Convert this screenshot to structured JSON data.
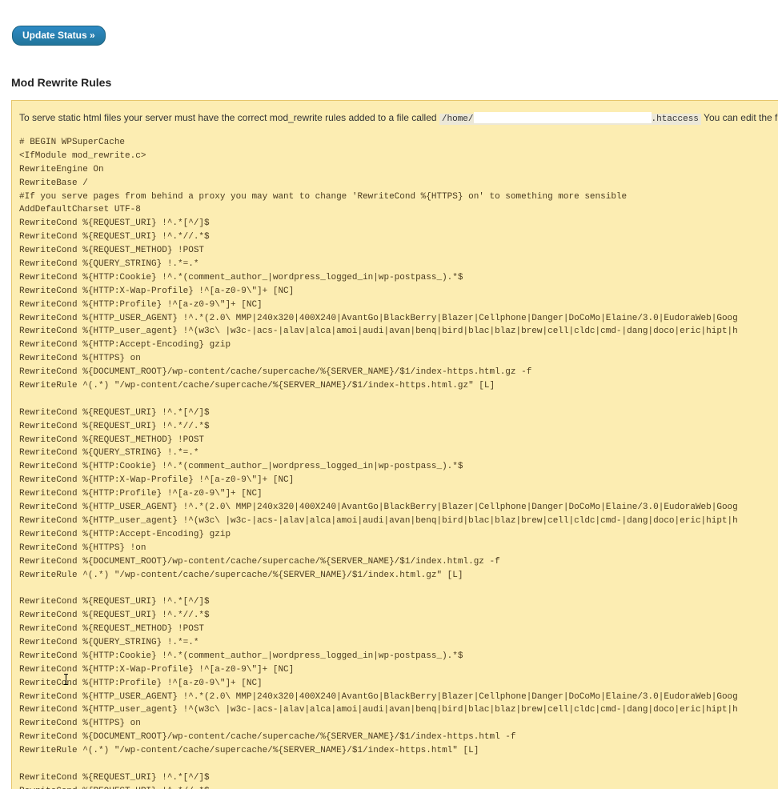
{
  "update_button": {
    "label": "Update Status »"
  },
  "section_title": "Mod Rewrite Rules",
  "notice": {
    "intro_before": "To serve static html files your server must have the correct mod_rewrite rules added to a file called ",
    "path_prefix": "/home/",
    "path_suffix": ".htaccess",
    "intro_after": " You can edit the f"
  },
  "rules_lines": [
    "# BEGIN WPSuperCache",
    "<IfModule mod_rewrite.c>",
    "RewriteEngine On",
    "RewriteBase /",
    "#If you serve pages from behind a proxy you may want to change 'RewriteCond %{HTTPS} on' to something more sensible",
    "AddDefaultCharset UTF-8",
    "RewriteCond %{REQUEST_URI} !^.*[^/]$",
    "RewriteCond %{REQUEST_URI} !^.*//.*$",
    "RewriteCond %{REQUEST_METHOD} !POST",
    "RewriteCond %{QUERY_STRING} !.*=.*",
    "RewriteCond %{HTTP:Cookie} !^.*(comment_author_|wordpress_logged_in|wp-postpass_).*$",
    "RewriteCond %{HTTP:X-Wap-Profile} !^[a-z0-9\\\"]+ [NC]",
    "RewriteCond %{HTTP:Profile} !^[a-z0-9\\\"]+ [NC]",
    "RewriteCond %{HTTP_USER_AGENT} !^.*(2.0\\ MMP|240x320|400X240|AvantGo|BlackBerry|Blazer|Cellphone|Danger|DoCoMo|Elaine/3.0|EudoraWeb|Goog",
    "RewriteCond %{HTTP_user_agent} !^(w3c\\ |w3c-|acs-|alav|alca|amoi|audi|avan|benq|bird|blac|blaz|brew|cell|cldc|cmd-|dang|doco|eric|hipt|h",
    "RewriteCond %{HTTP:Accept-Encoding} gzip",
    "RewriteCond %{HTTPS} on",
    "RewriteCond %{DOCUMENT_ROOT}/wp-content/cache/supercache/%{SERVER_NAME}/$1/index-https.html.gz -f",
    "RewriteRule ^(.*) \"/wp-content/cache/supercache/%{SERVER_NAME}/$1/index-https.html.gz\" [L]",
    "",
    "RewriteCond %{REQUEST_URI} !^.*[^/]$",
    "RewriteCond %{REQUEST_URI} !^.*//.*$",
    "RewriteCond %{REQUEST_METHOD} !POST",
    "RewriteCond %{QUERY_STRING} !.*=.*",
    "RewriteCond %{HTTP:Cookie} !^.*(comment_author_|wordpress_logged_in|wp-postpass_).*$",
    "RewriteCond %{HTTP:X-Wap-Profile} !^[a-z0-9\\\"]+ [NC]",
    "RewriteCond %{HTTP:Profile} !^[a-z0-9\\\"]+ [NC]",
    "RewriteCond %{HTTP_USER_AGENT} !^.*(2.0\\ MMP|240x320|400X240|AvantGo|BlackBerry|Blazer|Cellphone|Danger|DoCoMo|Elaine/3.0|EudoraWeb|Goog",
    "RewriteCond %{HTTP_user_agent} !^(w3c\\ |w3c-|acs-|alav|alca|amoi|audi|avan|benq|bird|blac|blaz|brew|cell|cldc|cmd-|dang|doco|eric|hipt|h",
    "RewriteCond %{HTTP:Accept-Encoding} gzip",
    "RewriteCond %{HTTPS} !on",
    "RewriteCond %{DOCUMENT_ROOT}/wp-content/cache/supercache/%{SERVER_NAME}/$1/index.html.gz -f",
    "RewriteRule ^(.*) \"/wp-content/cache/supercache/%{SERVER_NAME}/$1/index.html.gz\" [L]",
    "",
    "RewriteCond %{REQUEST_URI} !^.*[^/]$",
    "RewriteCond %{REQUEST_URI} !^.*//.*$",
    "RewriteCond %{REQUEST_METHOD} !POST",
    "RewriteCond %{QUERY_STRING} !.*=.*",
    "RewriteCond %{HTTP:Cookie} !^.*(comment_author_|wordpress_logged_in|wp-postpass_).*$",
    "RewriteCond %{HTTP:X-Wap-Profile} !^[a-z0-9\\\"]+ [NC]",
    "RewriteCond %{HTTP:Profile} !^[a-z0-9\\\"]+ [NC]",
    "RewriteCond %{HTTP_USER_AGENT} !^.*(2.0\\ MMP|240x320|400X240|AvantGo|BlackBerry|Blazer|Cellphone|Danger|DoCoMo|Elaine/3.0|EudoraWeb|Goog",
    "RewriteCond %{HTTP_user_agent} !^(w3c\\ |w3c-|acs-|alav|alca|amoi|audi|avan|benq|bird|blac|blaz|brew|cell|cldc|cmd-|dang|doco|eric|hipt|h",
    "RewriteCond %{HTTPS} on",
    "RewriteCond %{DOCUMENT_ROOT}/wp-content/cache/supercache/%{SERVER_NAME}/$1/index-https.html -f",
    "RewriteRule ^(.*) \"/wp-content/cache/supercache/%{SERVER_NAME}/$1/index-https.html\" [L]",
    "",
    "RewriteCond %{REQUEST_URI} !^.*[^/]$",
    "RewriteCond %{REQUEST_URI} !^.*//.*$"
  ]
}
